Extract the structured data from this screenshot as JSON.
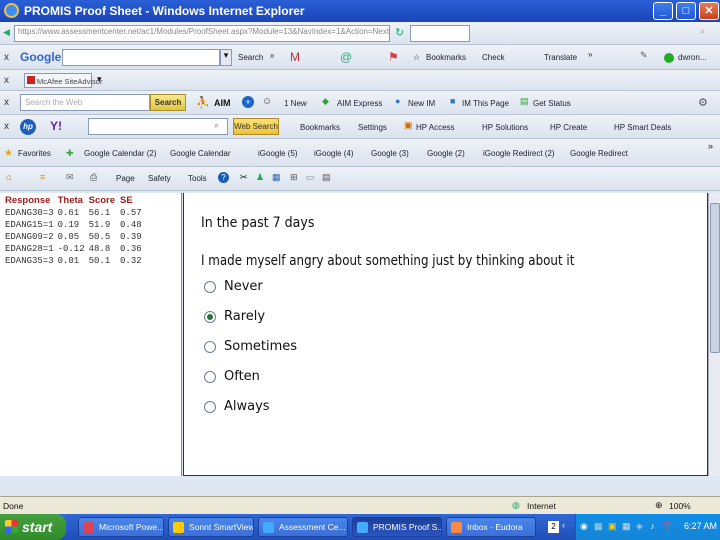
{
  "window": {
    "title": "PROMIS Proof Sheet - Windows Internet Explorer",
    "buttons": [
      "_",
      "□",
      "✕"
    ]
  },
  "address": {
    "url": "https://www.assessmentcenter.net/ac1/Modules/ProofSheet.aspx?Module=13&NavIndex=1&Action=Next",
    "google_label": "Google",
    "search_label": "Search",
    "more": "»",
    "bookmarks": "Bookmarks",
    "check": "Check",
    "translate": "Translate",
    "user": "dwron..."
  },
  "mcafee": {
    "label": "McAfee SiteAdvisor"
  },
  "aim": {
    "search_placeholder": "Search the Web",
    "search_btn": "Search",
    "aim": "AIM",
    "new": "1 New",
    "express": "AIM Express",
    "new_im": "New IM",
    "im_page": "IM This Page",
    "get_status": "Get Status"
  },
  "hp": {
    "web_search": "Web Search",
    "bookmarks": "Bookmarks",
    "settings": "Settings",
    "access": "HP Access",
    "solutions": "HP Solutions",
    "create": "HP Create",
    "smart_deals": "HP Smart Deals"
  },
  "favorites": {
    "label": "Favorites",
    "items": [
      "Google Calendar (2)",
      "Google Calendar",
      "iGoogle (5)",
      "iGoogle (4)",
      "Google (3)",
      "Google (2)",
      "iGoogle Redirect (2)",
      "Google Redirect"
    ]
  },
  "cmd": {
    "page": "Page",
    "safety": "Safety",
    "tools": "Tools"
  },
  "results": {
    "headers": [
      "Response",
      "Theta",
      "Score",
      "SE"
    ],
    "rows": [
      [
        "EDANG30=3",
        "0.61",
        "56.1",
        "0.57"
      ],
      [
        "EDANG15=1",
        "0.19",
        "51.9",
        "0.48"
      ],
      [
        "EDANG09=2",
        "0.05",
        "50.5",
        "0.39"
      ],
      [
        "EDANG28=1",
        "-0.12",
        "48.8",
        "0.36"
      ],
      [
        "EDANG35=3",
        "0.01",
        "50.1",
        "0.32"
      ]
    ]
  },
  "question": {
    "context": "In the past 7 days",
    "text": "I made myself angry about something just by thinking about it",
    "options": [
      {
        "label": "Never",
        "selected": false
      },
      {
        "label": "Rarely",
        "selected": true
      },
      {
        "label": "Sometimes",
        "selected": false
      },
      {
        "label": "Often",
        "selected": false
      },
      {
        "label": "Always",
        "selected": false
      }
    ]
  },
  "status": {
    "left": "Done",
    "zone": "Internet",
    "zoom": "100%"
  },
  "taskbar": {
    "start": "start",
    "tasks": [
      "Microsoft Powe...",
      "Sonnt SmartView",
      "Assessment Ce...",
      "PROMIS Proof S...",
      "Inbox - Eudora"
    ],
    "clock": "6:27 AM",
    "tray_num": "2"
  },
  "colors": {
    "accent": "#1b45b8",
    "header_red": "#9b1b1b",
    "selected_radio": "#2f6f3a"
  }
}
